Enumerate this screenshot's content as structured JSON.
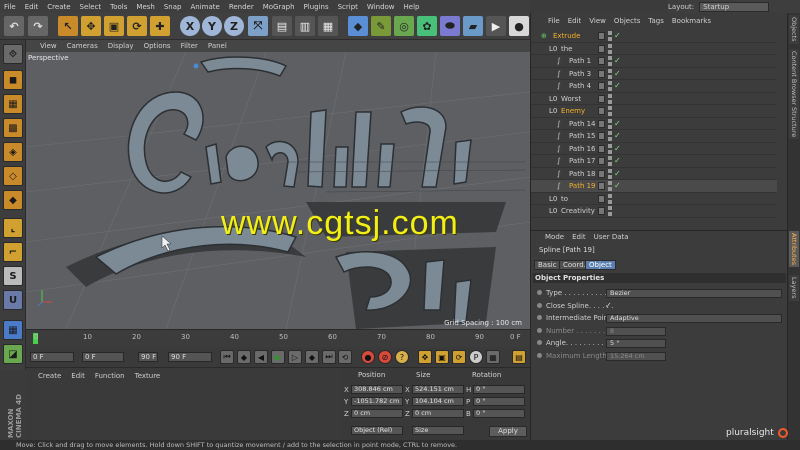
{
  "menubar": {
    "items": [
      "File",
      "Edit",
      "Create",
      "Select",
      "Tools",
      "Mesh",
      "Snap",
      "Animate",
      "Render",
      "MoGraph",
      "Plugins",
      "Script",
      "Window",
      "Help"
    ]
  },
  "layout": {
    "label": "Layout:",
    "value": "Startup"
  },
  "viewport": {
    "menu": [
      "View",
      "Cameras",
      "Display",
      "Options",
      "Filter",
      "Panel"
    ],
    "projection": "Perspective",
    "grid_spacing": "Grid Spacing : 100 cm",
    "scene_text": "Creativity",
    "watermark": "www.cgtsj.com"
  },
  "timeline": {
    "ticks": [
      "0",
      "10",
      "20",
      "30",
      "40",
      "50",
      "60",
      "70",
      "80",
      "90"
    ],
    "end_frame": "0 F",
    "start_field": "0 F",
    "min_field": "0 F",
    "max_field": "90 F",
    "end_field": "90 F"
  },
  "material_manager": {
    "menu": [
      "Create",
      "Edit",
      "Function",
      "Texture"
    ]
  },
  "coordinates": {
    "headers": [
      "Position",
      "Size",
      "Rotation"
    ],
    "rows": [
      {
        "axis": "X",
        "pos": "308.846 cm",
        "size_axis": "X",
        "size": "524.151 cm",
        "rot_axis": "H",
        "rot": "0 °"
      },
      {
        "axis": "Y",
        "pos": "-1051.782 cm",
        "size_axis": "Y",
        "size": "104.104 cm",
        "rot_axis": "P",
        "rot": "0 °"
      },
      {
        "axis": "Z",
        "pos": "0 cm",
        "size_axis": "Z",
        "size": "0 cm",
        "rot_axis": "B",
        "rot": "0 °"
      }
    ],
    "mode_select": "Object (Rel)",
    "size_select": "Size",
    "apply_label": "Apply"
  },
  "objects": {
    "menu": [
      "File",
      "Edit",
      "View",
      "Objects",
      "Tags",
      "Bookmarks"
    ],
    "rows": [
      {
        "name": "Extrude",
        "indent": 0,
        "state": "selected"
      },
      {
        "name": "the",
        "indent": 1,
        "state": ""
      },
      {
        "name": "Path 1",
        "indent": 2,
        "state": ""
      },
      {
        "name": "Path 3",
        "indent": 2,
        "state": ""
      },
      {
        "name": "Path 4",
        "indent": 2,
        "state": ""
      },
      {
        "name": "Worst",
        "indent": 1,
        "state": ""
      },
      {
        "name": "Enemy",
        "indent": 1,
        "state": "selected"
      },
      {
        "name": "Path 14",
        "indent": 2,
        "state": ""
      },
      {
        "name": "Path 15",
        "indent": 2,
        "state": ""
      },
      {
        "name": "Path 16",
        "indent": 2,
        "state": ""
      },
      {
        "name": "Path 17",
        "indent": 2,
        "state": ""
      },
      {
        "name": "Path 18",
        "indent": 2,
        "state": ""
      },
      {
        "name": "Path 19",
        "indent": 2,
        "state": "active"
      },
      {
        "name": "to",
        "indent": 1,
        "state": ""
      },
      {
        "name": "Creativity",
        "indent": 1,
        "state": ""
      }
    ]
  },
  "attributes": {
    "menu": [
      "Mode",
      "Edit",
      "User Data"
    ],
    "object_label": "Spline [Path 19]",
    "tabs": [
      "Basic",
      "Coord.",
      "Object"
    ],
    "active_tab": "Object",
    "section": "Object Properties",
    "props": [
      {
        "label": "Type . . . . . . . . . .",
        "value": "Bezier",
        "kind": "dropdown"
      },
      {
        "label": "Close Spline. . . . . .",
        "value": "✓",
        "kind": "check"
      },
      {
        "label": "Intermediate Points",
        "value": "Adaptive",
        "kind": "dropdown"
      },
      {
        "label": "Number . . . . . . . . .",
        "value": "8",
        "kind": "field_dim"
      },
      {
        "label": "Angle. . . . . . . . . .",
        "value": "5 °",
        "kind": "field"
      },
      {
        "label": "Maximum Length. . .",
        "value": "15.264 cm",
        "kind": "field_dim"
      }
    ]
  },
  "side_tabs": [
    "Objects",
    "Content Browser",
    "Structure",
    "Attributes",
    "Layers"
  ],
  "status": "Move: Click and drag to move elements. Hold down SHIFT to quantize movement / add to the selection in point mode, CTRL to remove.",
  "branding": {
    "maxon": "MAXON CINEMA 4D",
    "pluralsight": "pluralsight"
  },
  "colors": {
    "selected_text": "#f3b12a",
    "active_tab": "#5a7fb0",
    "watermark": "#f2ee17",
    "check": "#7fe07f"
  }
}
